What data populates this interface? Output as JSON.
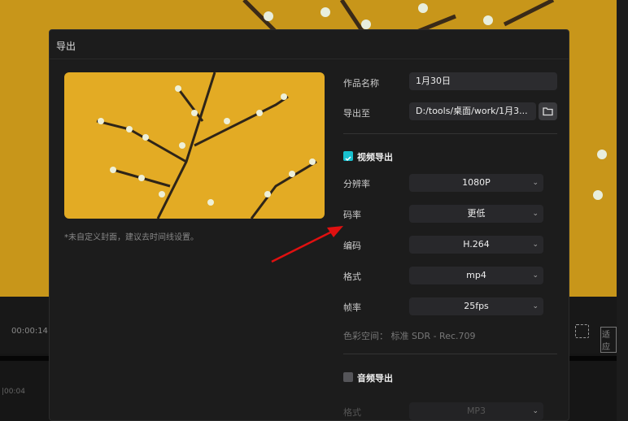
{
  "dialog": {
    "title": "导出",
    "cover_note": "*未自定义封面，建议去时间线设置。"
  },
  "form": {
    "name_label": "作品名称",
    "name_value": "1月30日",
    "path_label": "导出至",
    "path_value": "D:/tools/桌面/work/1月3...",
    "video_section": "视频导出",
    "video_checked": true,
    "resolution_label": "分辨率",
    "resolution_value": "1080P",
    "bitrate_label": "码率",
    "bitrate_value": "更低",
    "codec_label": "编码",
    "codec_value": "H.264",
    "format_label": "格式",
    "format_value": "mp4",
    "fps_label": "帧率",
    "fps_value": "25fps",
    "colorspace": "色彩空间：  标准 SDR - Rec.709",
    "audio_section": "音频导出",
    "audio_checked": false,
    "audio_format_label": "格式",
    "audio_format_value": "MP3"
  },
  "editor": {
    "time": "00:00:14:",
    "timeline_mark": "|00:04",
    "fit_label": "适应"
  },
  "colors": {
    "accent": "#19c1cf",
    "arrow": "#e01010"
  }
}
